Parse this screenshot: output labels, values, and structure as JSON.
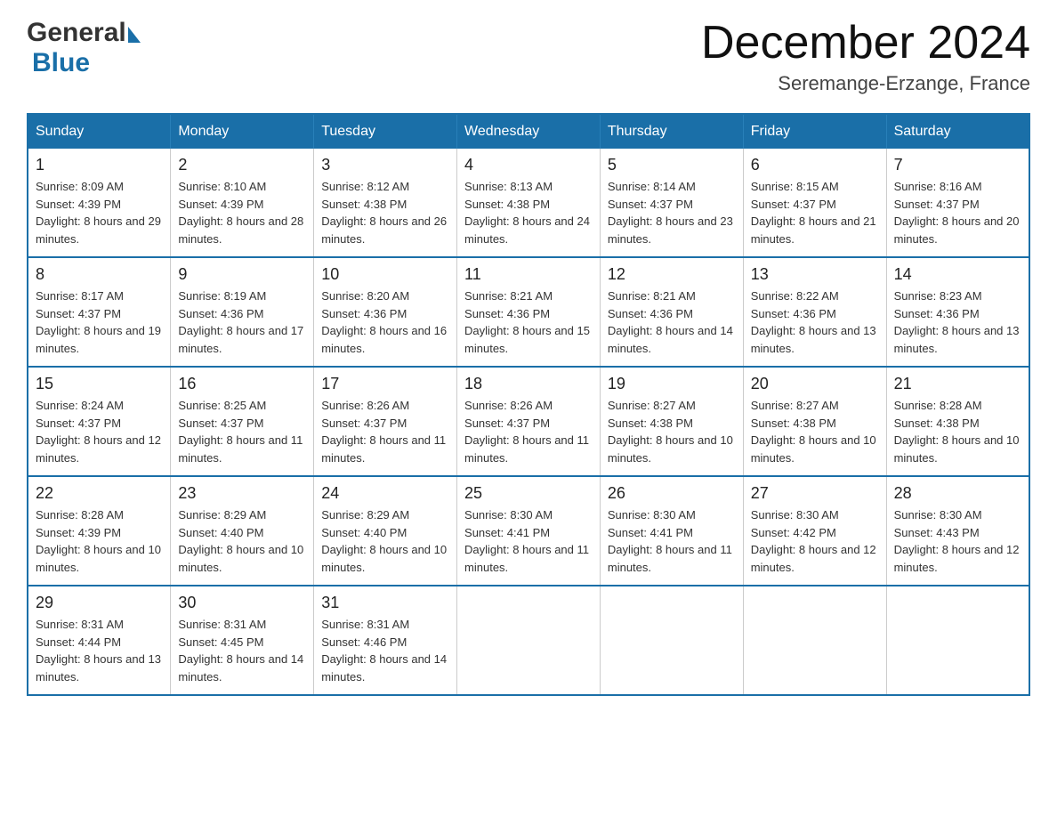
{
  "header": {
    "logo_general": "General",
    "logo_blue": "Blue",
    "month_title": "December 2024",
    "location": "Seremange-Erzange, France"
  },
  "weekdays": [
    "Sunday",
    "Monday",
    "Tuesday",
    "Wednesday",
    "Thursday",
    "Friday",
    "Saturday"
  ],
  "weeks": [
    [
      {
        "day": "1",
        "sunrise": "8:09 AM",
        "sunset": "4:39 PM",
        "daylight": "8 hours and 29 minutes."
      },
      {
        "day": "2",
        "sunrise": "8:10 AM",
        "sunset": "4:39 PM",
        "daylight": "8 hours and 28 minutes."
      },
      {
        "day": "3",
        "sunrise": "8:12 AM",
        "sunset": "4:38 PM",
        "daylight": "8 hours and 26 minutes."
      },
      {
        "day": "4",
        "sunrise": "8:13 AM",
        "sunset": "4:38 PM",
        "daylight": "8 hours and 24 minutes."
      },
      {
        "day": "5",
        "sunrise": "8:14 AM",
        "sunset": "4:37 PM",
        "daylight": "8 hours and 23 minutes."
      },
      {
        "day": "6",
        "sunrise": "8:15 AM",
        "sunset": "4:37 PM",
        "daylight": "8 hours and 21 minutes."
      },
      {
        "day": "7",
        "sunrise": "8:16 AM",
        "sunset": "4:37 PM",
        "daylight": "8 hours and 20 minutes."
      }
    ],
    [
      {
        "day": "8",
        "sunrise": "8:17 AM",
        "sunset": "4:37 PM",
        "daylight": "8 hours and 19 minutes."
      },
      {
        "day": "9",
        "sunrise": "8:19 AM",
        "sunset": "4:36 PM",
        "daylight": "8 hours and 17 minutes."
      },
      {
        "day": "10",
        "sunrise": "8:20 AM",
        "sunset": "4:36 PM",
        "daylight": "8 hours and 16 minutes."
      },
      {
        "day": "11",
        "sunrise": "8:21 AM",
        "sunset": "4:36 PM",
        "daylight": "8 hours and 15 minutes."
      },
      {
        "day": "12",
        "sunrise": "8:21 AM",
        "sunset": "4:36 PM",
        "daylight": "8 hours and 14 minutes."
      },
      {
        "day": "13",
        "sunrise": "8:22 AM",
        "sunset": "4:36 PM",
        "daylight": "8 hours and 13 minutes."
      },
      {
        "day": "14",
        "sunrise": "8:23 AM",
        "sunset": "4:36 PM",
        "daylight": "8 hours and 13 minutes."
      }
    ],
    [
      {
        "day": "15",
        "sunrise": "8:24 AM",
        "sunset": "4:37 PM",
        "daylight": "8 hours and 12 minutes."
      },
      {
        "day": "16",
        "sunrise": "8:25 AM",
        "sunset": "4:37 PM",
        "daylight": "8 hours and 11 minutes."
      },
      {
        "day": "17",
        "sunrise": "8:26 AM",
        "sunset": "4:37 PM",
        "daylight": "8 hours and 11 minutes."
      },
      {
        "day": "18",
        "sunrise": "8:26 AM",
        "sunset": "4:37 PM",
        "daylight": "8 hours and 11 minutes."
      },
      {
        "day": "19",
        "sunrise": "8:27 AM",
        "sunset": "4:38 PM",
        "daylight": "8 hours and 10 minutes."
      },
      {
        "day": "20",
        "sunrise": "8:27 AM",
        "sunset": "4:38 PM",
        "daylight": "8 hours and 10 minutes."
      },
      {
        "day": "21",
        "sunrise": "8:28 AM",
        "sunset": "4:38 PM",
        "daylight": "8 hours and 10 minutes."
      }
    ],
    [
      {
        "day": "22",
        "sunrise": "8:28 AM",
        "sunset": "4:39 PM",
        "daylight": "8 hours and 10 minutes."
      },
      {
        "day": "23",
        "sunrise": "8:29 AM",
        "sunset": "4:40 PM",
        "daylight": "8 hours and 10 minutes."
      },
      {
        "day": "24",
        "sunrise": "8:29 AM",
        "sunset": "4:40 PM",
        "daylight": "8 hours and 10 minutes."
      },
      {
        "day": "25",
        "sunrise": "8:30 AM",
        "sunset": "4:41 PM",
        "daylight": "8 hours and 11 minutes."
      },
      {
        "day": "26",
        "sunrise": "8:30 AM",
        "sunset": "4:41 PM",
        "daylight": "8 hours and 11 minutes."
      },
      {
        "day": "27",
        "sunrise": "8:30 AM",
        "sunset": "4:42 PM",
        "daylight": "8 hours and 12 minutes."
      },
      {
        "day": "28",
        "sunrise": "8:30 AM",
        "sunset": "4:43 PM",
        "daylight": "8 hours and 12 minutes."
      }
    ],
    [
      {
        "day": "29",
        "sunrise": "8:31 AM",
        "sunset": "4:44 PM",
        "daylight": "8 hours and 13 minutes."
      },
      {
        "day": "30",
        "sunrise": "8:31 AM",
        "sunset": "4:45 PM",
        "daylight": "8 hours and 14 minutes."
      },
      {
        "day": "31",
        "sunrise": "8:31 AM",
        "sunset": "4:46 PM",
        "daylight": "8 hours and 14 minutes."
      },
      null,
      null,
      null,
      null
    ]
  ]
}
